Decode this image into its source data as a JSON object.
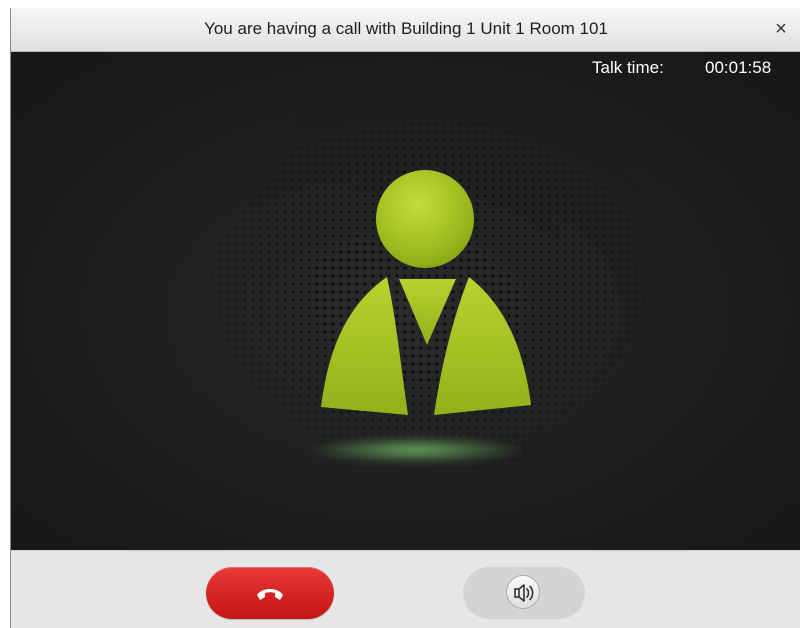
{
  "window": {
    "title": "You are having a call with Building 1 Unit 1 Room 101",
    "close_symbol": "×"
  },
  "call": {
    "talk_time_label": "Talk time:",
    "talk_time_value": "00:01:58"
  },
  "controls": {
    "hangup_icon": "hang-up-phone-icon",
    "speaker_icon": "speaker-volume-icon"
  },
  "colors": {
    "avatar_green": "#9dbb1f",
    "hangup_red": "#d42020",
    "stage_background": "#1e1e1e"
  }
}
